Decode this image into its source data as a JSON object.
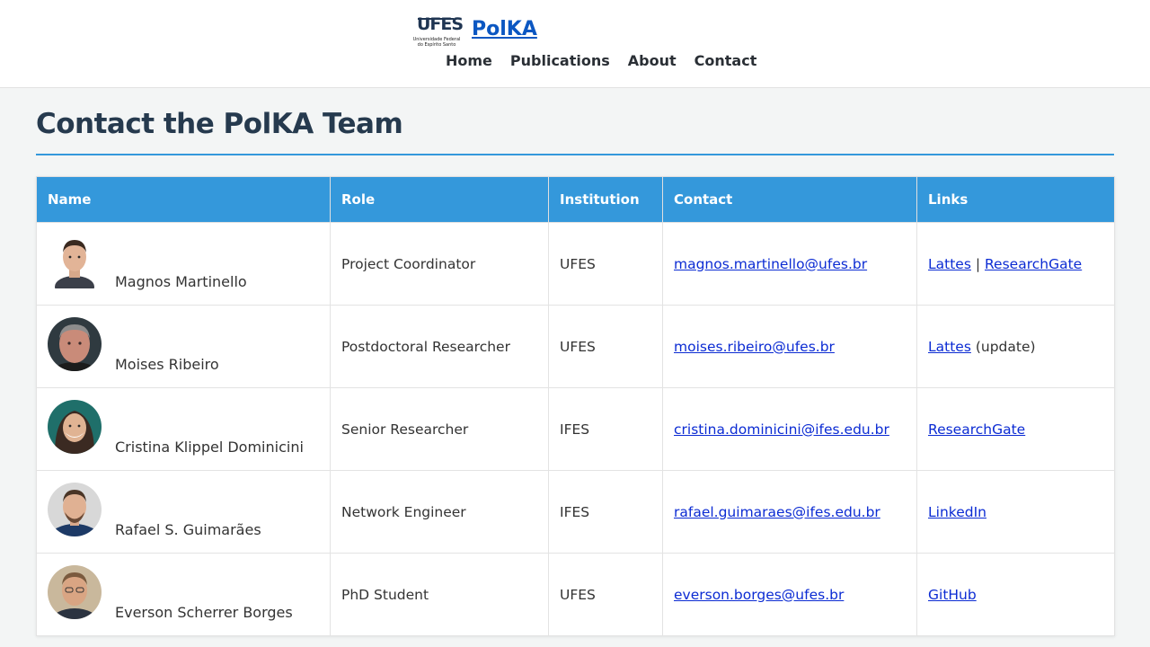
{
  "header": {
    "logo": {
      "mark": "UFES",
      "subtitle_line1": "Universidade Federal",
      "subtitle_line2": "do Espírito Santo"
    },
    "site_title": "PolKA",
    "nav": [
      {
        "label": "Home"
      },
      {
        "label": "Publications"
      },
      {
        "label": "About"
      },
      {
        "label": "Contact"
      }
    ]
  },
  "main": {
    "title": "Contact the PolKA Team",
    "accent_color": "#3498db",
    "table": {
      "headers": [
        "Name",
        "Role",
        "Institution",
        "Contact",
        "Links"
      ],
      "rows": [
        {
          "name": "Magnos Martinello",
          "role": "Project Coordinator",
          "institution": "UFES",
          "email": "magnos.martinello@ufes.br",
          "links": [
            {
              "label": "Lattes"
            },
            {
              "label": "ResearchGate"
            }
          ],
          "link_separator": " | ",
          "note": ""
        },
        {
          "name": "Moises Ribeiro",
          "role": "Postdoctoral Researcher",
          "institution": "UFES",
          "email": "moises.ribeiro@ufes.br",
          "links": [
            {
              "label": "Lattes"
            }
          ],
          "note": " (update)"
        },
        {
          "name": "Cristina Klippel Dominicini",
          "role": "Senior Researcher",
          "institution": "IFES",
          "email": "cristina.dominicini@ifes.edu.br",
          "links": [
            {
              "label": "ResearchGate"
            }
          ],
          "note": ""
        },
        {
          "name": "Rafael S. Guimarães",
          "role": "Network Engineer",
          "institution": "IFES",
          "email": "rafael.guimaraes@ifes.edu.br",
          "links": [
            {
              "label": "LinkedIn"
            }
          ],
          "note": ""
        },
        {
          "name": "Everson Scherrer Borges",
          "role": "PhD Student",
          "institution": "UFES",
          "email": "everson.borges@ufes.br",
          "links": [
            {
              "label": "GitHub"
            }
          ],
          "note": ""
        }
      ]
    }
  }
}
